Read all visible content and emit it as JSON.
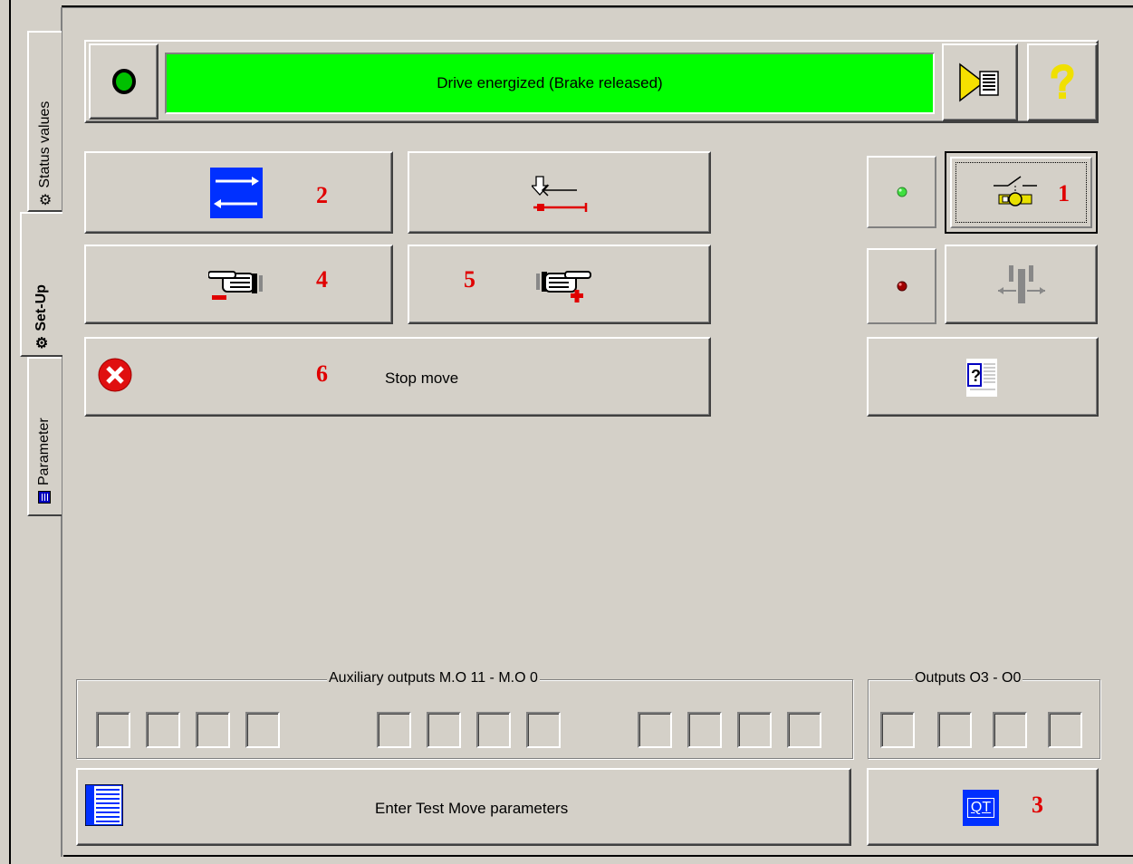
{
  "tabs": [
    {
      "label": "Status values",
      "icon": "gear-icon"
    },
    {
      "label": "Set-Up",
      "icon": "gear-icon",
      "active": true
    },
    {
      "label": "Parameter",
      "icon": "list-icon"
    }
  ],
  "status": {
    "text": "Drive energized (Brake released)",
    "bar_color": "#00ff00",
    "indicator_color": "#00c000"
  },
  "buttons": {
    "stop_move": "Stop move",
    "enter_test_move": "Enter Test Move parameters",
    "qt_label": "QT"
  },
  "markers": {
    "enable": "1",
    "toggle_direction": "2",
    "qt": "3",
    "jog_minus": "4",
    "jog_plus": "5",
    "stop": "6"
  },
  "groups": {
    "auxiliary_outputs": "Auxiliary outputs M.O 11 - M.O 0",
    "outputs": "Outputs O3 - O0"
  },
  "leds": {
    "enable_led_color": "#40e040",
    "limit_led_color": "#a00000"
  }
}
